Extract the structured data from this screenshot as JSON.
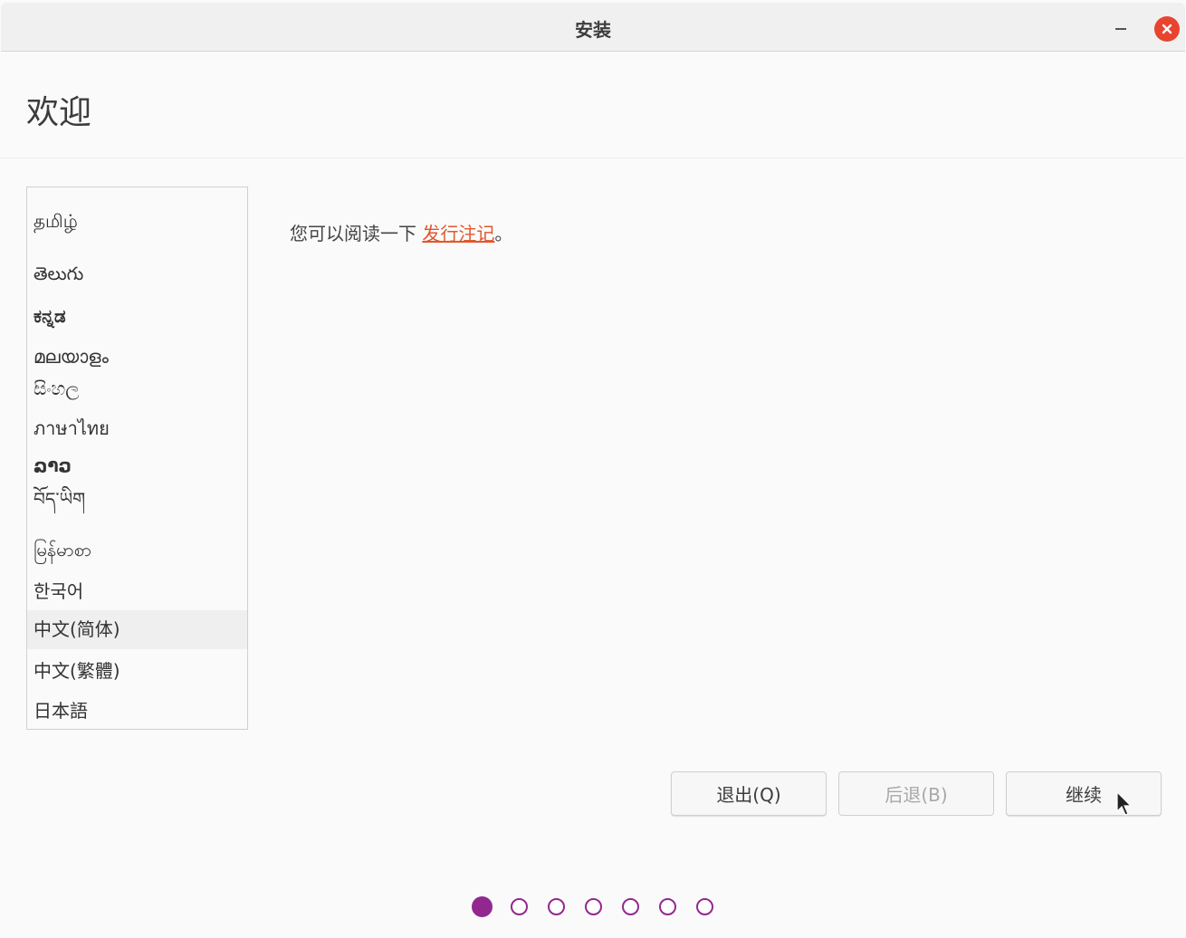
{
  "window": {
    "title": "安装",
    "minimize_label": "minimize",
    "close_label": "close"
  },
  "header": {
    "title": "欢迎"
  },
  "languages": {
    "items": [
      {
        "label": "தமிழ்",
        "selected": false
      },
      {
        "label": "తెలుగు",
        "selected": false
      },
      {
        "label": "ಕನ್ನಡ",
        "selected": false
      },
      {
        "label": "മലയാളം",
        "selected": false
      },
      {
        "label": "සිංහල",
        "selected": false
      },
      {
        "label": "ภาษาไทย",
        "selected": false
      },
      {
        "label": "ລາວ",
        "selected": false
      },
      {
        "label": "བོད་ཡིག",
        "selected": false
      },
      {
        "label": "မြန်မာစာ",
        "selected": false
      },
      {
        "label": "한국어",
        "selected": false
      },
      {
        "label": "中文(简体)",
        "selected": true
      },
      {
        "label": "中文(繁體)",
        "selected": false
      },
      {
        "label": "日本語",
        "selected": false
      }
    ]
  },
  "main": {
    "release_prefix": "您可以阅读一下 ",
    "release_link": "发行注记",
    "release_suffix": "。"
  },
  "buttons": {
    "quit": "退出(Q)",
    "back": "后退(B)",
    "continue": "继续"
  },
  "progress": {
    "current_step": 1,
    "total_steps": 7
  },
  "colors": {
    "accent": "#92288f",
    "link": "#e2562b",
    "close": "#e8442f"
  }
}
